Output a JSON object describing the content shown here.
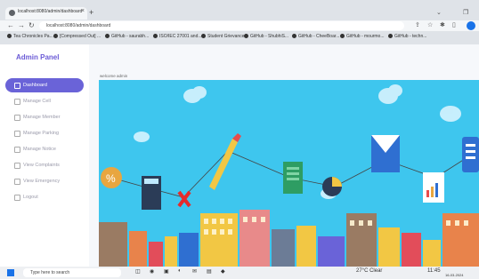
{
  "browser": {
    "tab_title": "localhost:8080/admin/dashboard",
    "new_tab": "+",
    "url": "localhost:8080/admin/dashboard",
    "bookmarks": [
      "Tea Chronicles Pa...",
      "[Compressed Out] ...",
      "GitHub - saurabh...",
      "ISO/IEC 27001 and...",
      "Student Grievance...",
      "GitHub - ShubhiS...",
      "GitHub - CheeBoar...",
      "GitHub - mourmo...",
      "GitHub - techn..."
    ]
  },
  "sidebar": {
    "brand": "Admin Panel",
    "items": [
      {
        "label": "Dashboard"
      },
      {
        "label": "Manage Cell"
      },
      {
        "label": "Manage Member"
      },
      {
        "label": "Manage Parking"
      },
      {
        "label": "Manage Notice"
      },
      {
        "label": "View Complaints"
      },
      {
        "label": "View Emergency"
      },
      {
        "label": "Logout"
      }
    ]
  },
  "main": {
    "welcome": "welcome admin"
  },
  "taskbar": {
    "search_placeholder": "Type here to search",
    "weather": "27°C Clear",
    "time": "11:45",
    "date": "16-03-2024"
  },
  "colors": {
    "accent": "#6a63d8",
    "brand": "#6b5bd6",
    "sky": "#3ec6ee"
  },
  "icons": [
    "back-icon",
    "forward-icon",
    "reload-icon",
    "star-icon",
    "extensions-icon",
    "windows-icon",
    "search-icon"
  ]
}
